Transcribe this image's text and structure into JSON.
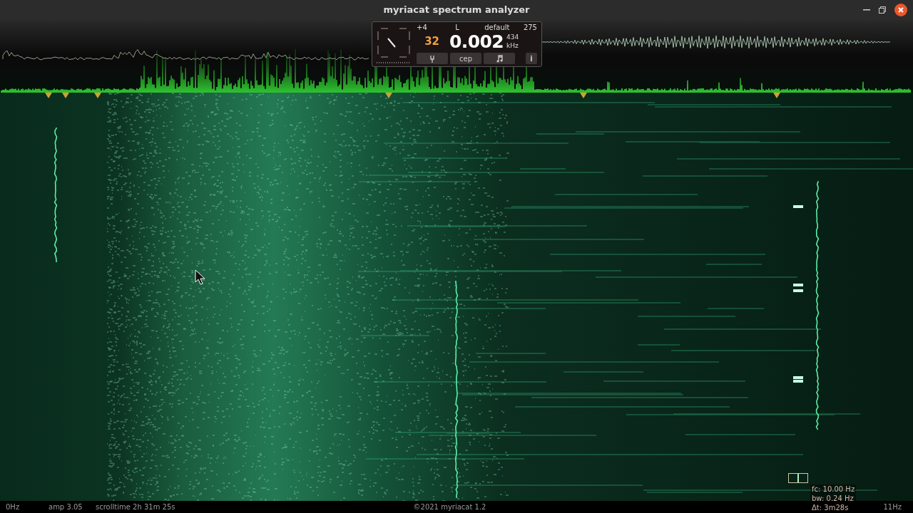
{
  "window": {
    "title": "myriacat spectrum analyzer"
  },
  "tuner": {
    "offset": "+4",
    "channel": "L",
    "preset": "default",
    "count": "275",
    "octave": "32",
    "frequency": "0.002",
    "cents": "434",
    "unit": "kHz",
    "buttons": [
      {
        "kind": "fork"
      },
      {
        "kind": "text",
        "label": "cep"
      },
      {
        "kind": "note"
      },
      {
        "kind": "info",
        "label": "i"
      }
    ]
  },
  "cursor_readout": {
    "fc": "fc: 10.00 Hz",
    "bw": "bw: 0.24 Hz",
    "dt": "Δt: 3m28s"
  },
  "status_bar": {
    "min_freq": "0Hz",
    "amp": "amp 3.05",
    "scrolltime": "scrolltime 2h 31m 25s",
    "copyright": "©2021 myriacat 1.2",
    "max_freq": "11Hz"
  }
}
